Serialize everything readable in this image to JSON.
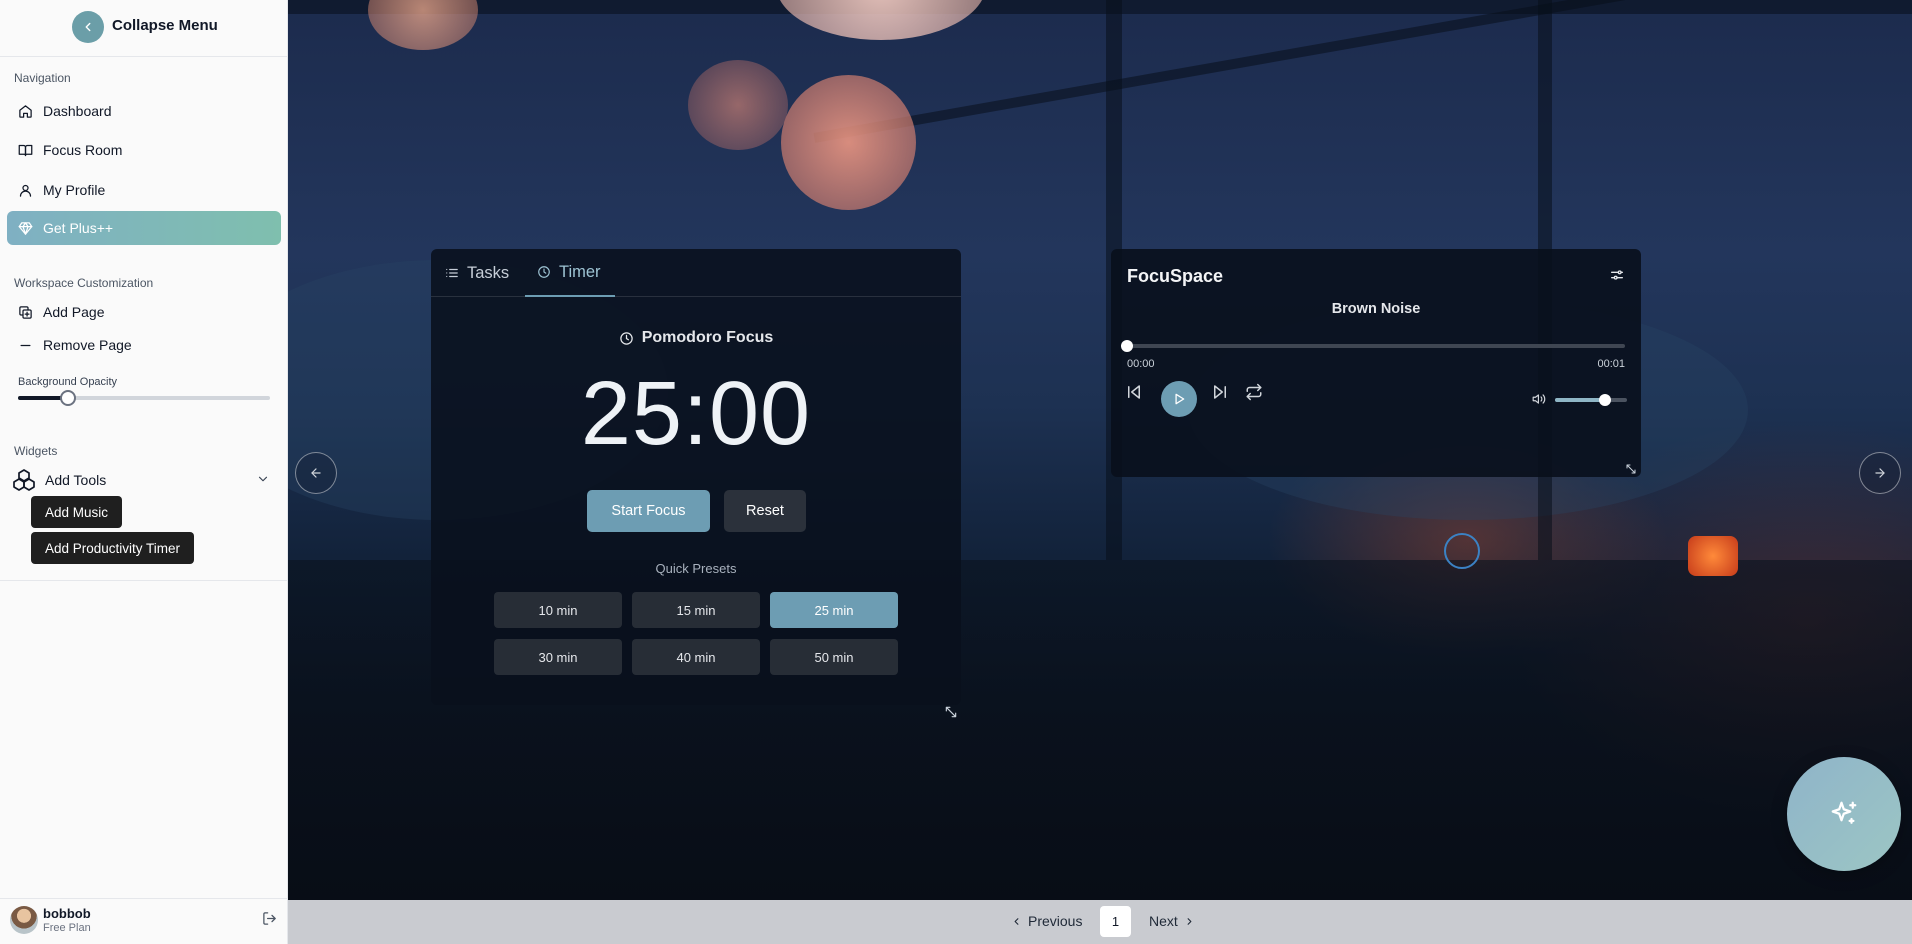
{
  "sidebar": {
    "collapse_label": "Collapse Menu",
    "navigation_heading": "Navigation",
    "nav_items": [
      {
        "label": "Dashboard",
        "icon": "home-icon"
      },
      {
        "label": "Focus Room",
        "icon": "book-open-icon"
      },
      {
        "label": "My Profile",
        "icon": "user-icon"
      },
      {
        "label": "Get Plus++",
        "icon": "gem-icon",
        "active": true
      }
    ],
    "workspace_heading": "Workspace Customization",
    "workspace_items": [
      {
        "label": "Add Page",
        "icon": "copy-plus-icon"
      },
      {
        "label": "Remove Page",
        "icon": "minus-icon"
      }
    ],
    "background_opacity": {
      "label": "Background Opacity",
      "value": 0.2
    },
    "widgets_heading": "Widgets",
    "add_tools_label": "Add Tools",
    "tool_buttons": [
      "Add Music",
      "Add Productivity Timer"
    ],
    "user": {
      "name": "bobbob",
      "plan": "Free Plan"
    }
  },
  "timer_widget": {
    "tabs": [
      {
        "label": "Tasks",
        "icon": "list-icon"
      },
      {
        "label": "Timer",
        "icon": "clock-icon",
        "active": true
      }
    ],
    "heading": "Pomodoro Focus",
    "time": "25:00",
    "start_label": "Start Focus",
    "reset_label": "Reset",
    "presets_label": "Quick Presets",
    "presets": [
      "10 min",
      "15 min",
      "25 min",
      "30 min",
      "40 min",
      "50 min"
    ],
    "selected_preset": "25 min"
  },
  "music_widget": {
    "title": "FocuSpace",
    "track": "Brown Noise",
    "current_time": "00:00",
    "duration": "00:01",
    "progress": 0,
    "volume": 0.7
  },
  "pagination": {
    "previous_label": "Previous",
    "current_page": "1",
    "next_label": "Next"
  },
  "colors": {
    "accent": "#6d9db3",
    "active_nav_gradient": [
      "#7fb0c3",
      "#7fbfae"
    ],
    "sidebar_bg": "#fafafa",
    "widget_bg": "#09101c"
  }
}
